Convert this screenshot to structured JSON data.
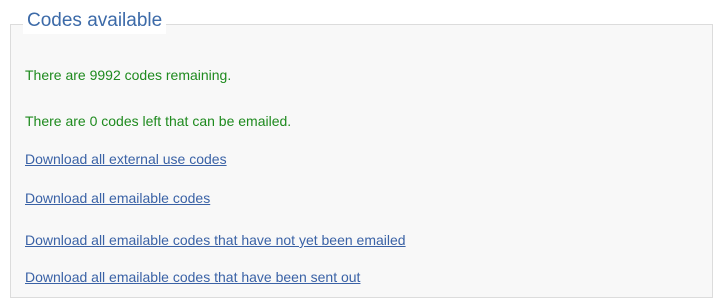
{
  "fieldset": {
    "legend": "Codes available"
  },
  "status": {
    "remaining": "There are 9992 codes remaining.",
    "emailable_left": "There are 0 codes left that can be emailed."
  },
  "links": {
    "external": "Download all external use codes",
    "emailable": "Download all emailable codes",
    "not_yet_emailed": "Download all emailable codes that have not yet been emailed",
    "sent_out": "Download all emailable codes that have been sent out"
  },
  "colors": {
    "legend_text": "#3c6aa8",
    "status_text": "#1e8a1e",
    "link_text": "#3a62a6",
    "panel_bg": "#f8f8f8",
    "panel_border": "#dcdcdc"
  }
}
